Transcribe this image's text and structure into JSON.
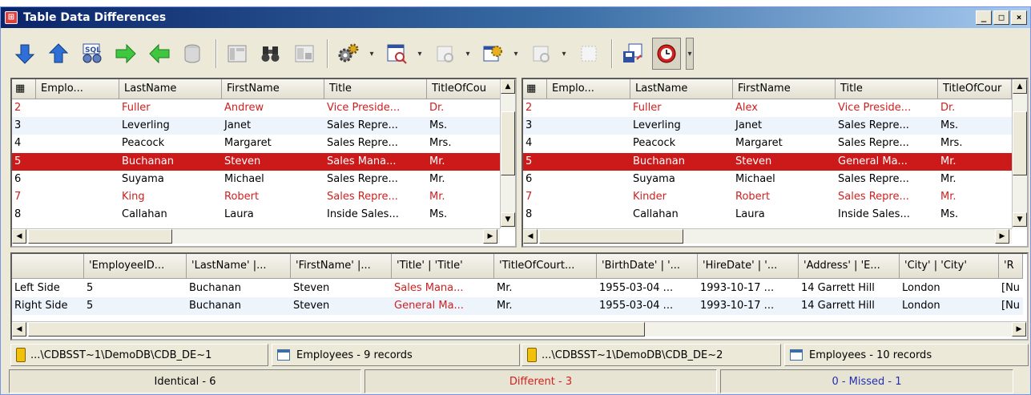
{
  "window": {
    "title": "Table Data Differences",
    "app_icon": "compare-app-icon"
  },
  "window_buttons": {
    "minimize": "_",
    "maximize": "□",
    "close": "×"
  },
  "left_grid": {
    "columns": [
      "Emplo...",
      "LastName",
      "FirstName",
      "Title",
      "TitleOfCou"
    ],
    "rows": [
      {
        "id": "2",
        "last": "Fuller",
        "first": "Andrew",
        "title": "Vice Preside...",
        "toc": "Dr.",
        "state": "diff"
      },
      {
        "id": "3",
        "last": "Leverling",
        "first": "Janet",
        "title": "Sales Repre...",
        "toc": "Ms.",
        "state": "alt"
      },
      {
        "id": "4",
        "last": "Peacock",
        "first": "Margaret",
        "title": "Sales Repre...",
        "toc": "Mrs.",
        "state": ""
      },
      {
        "id": "5",
        "last": "Buchanan",
        "first": "Steven",
        "title": "Sales Mana...",
        "toc": "Mr.",
        "state": "sel"
      },
      {
        "id": "6",
        "last": "Suyama",
        "first": "Michael",
        "title": "Sales Repre...",
        "toc": "Mr.",
        "state": ""
      },
      {
        "id": "7",
        "last": "King",
        "first": "Robert",
        "title": "Sales Repre...",
        "toc": "Mr.",
        "state": "diff"
      },
      {
        "id": "8",
        "last": "Callahan",
        "first": "Laura",
        "title": "Inside Sales...",
        "toc": "Ms.",
        "state": ""
      }
    ]
  },
  "right_grid": {
    "columns": [
      "Emplo...",
      "LastName",
      "FirstName",
      "Title",
      "TitleOfCour"
    ],
    "rows": [
      {
        "id": "2",
        "last": "Fuller",
        "first": "Alex",
        "title": "Vice Preside...",
        "toc": "Dr.",
        "state": "diff"
      },
      {
        "id": "3",
        "last": "Leverling",
        "first": "Janet",
        "title": "Sales Repre...",
        "toc": "Ms.",
        "state": "alt"
      },
      {
        "id": "4",
        "last": "Peacock",
        "first": "Margaret",
        "title": "Sales Repre...",
        "toc": "Mrs.",
        "state": ""
      },
      {
        "id": "5",
        "last": "Buchanan",
        "first": "Steven",
        "title": "General Ma...",
        "toc": "Mr.",
        "state": "sel"
      },
      {
        "id": "6",
        "last": "Suyama",
        "first": "Michael",
        "title": "Sales Repre...",
        "toc": "Mr.",
        "state": ""
      },
      {
        "id": "7",
        "last": "Kinder",
        "first": "Robert",
        "title": "Sales Repre...",
        "toc": "Mr.",
        "state": "diff"
      },
      {
        "id": "8",
        "last": "Callahan",
        "first": "Laura",
        "title": "Inside Sales...",
        "toc": "Ms.",
        "state": ""
      }
    ]
  },
  "detail_grid": {
    "columns": [
      "",
      "'EmployeeID...",
      "'LastName' |...",
      "'FirstName' |...",
      "'Title' | 'Title'",
      "'TitleOfCourt...",
      "'BirthDate' | '...",
      "'HireDate' | '...",
      "'Address' | 'E...",
      "'City' | 'City'",
      "'R"
    ],
    "rows": [
      {
        "side": "Left Side",
        "cells": [
          "5",
          "Buchanan",
          "Steven",
          "Sales Mana...",
          "Mr.",
          "1955-03-04 ...",
          "1993-10-17 ...",
          "14 Garrett Hill",
          "London",
          "[Nu"
        ]
      },
      {
        "side": "Right Side",
        "cells": [
          "5",
          "Buchanan",
          "Steven",
          "General Ma...",
          "Mr.",
          "1955-03-04 ...",
          "1993-10-17 ...",
          "14 Garrett Hill",
          "London",
          "[Nu"
        ]
      }
    ],
    "diff_column_index": 3
  },
  "info": {
    "left_db": "...\\CDBSST~1\\DemoDB\\CDB_DE~1",
    "left_table": "Employees  - 9 records",
    "right_db": "...\\CDBSST~1\\DemoDB\\CDB_DE~2",
    "right_table": "Employees  - 10 records"
  },
  "summary": {
    "identical": "Identical - 6",
    "different": "Different - 3",
    "missed": "0 - Missed - 1"
  },
  "colors": {
    "diff": "#d02020",
    "selected": "#cc1a1a",
    "missed": "#2030b0"
  }
}
